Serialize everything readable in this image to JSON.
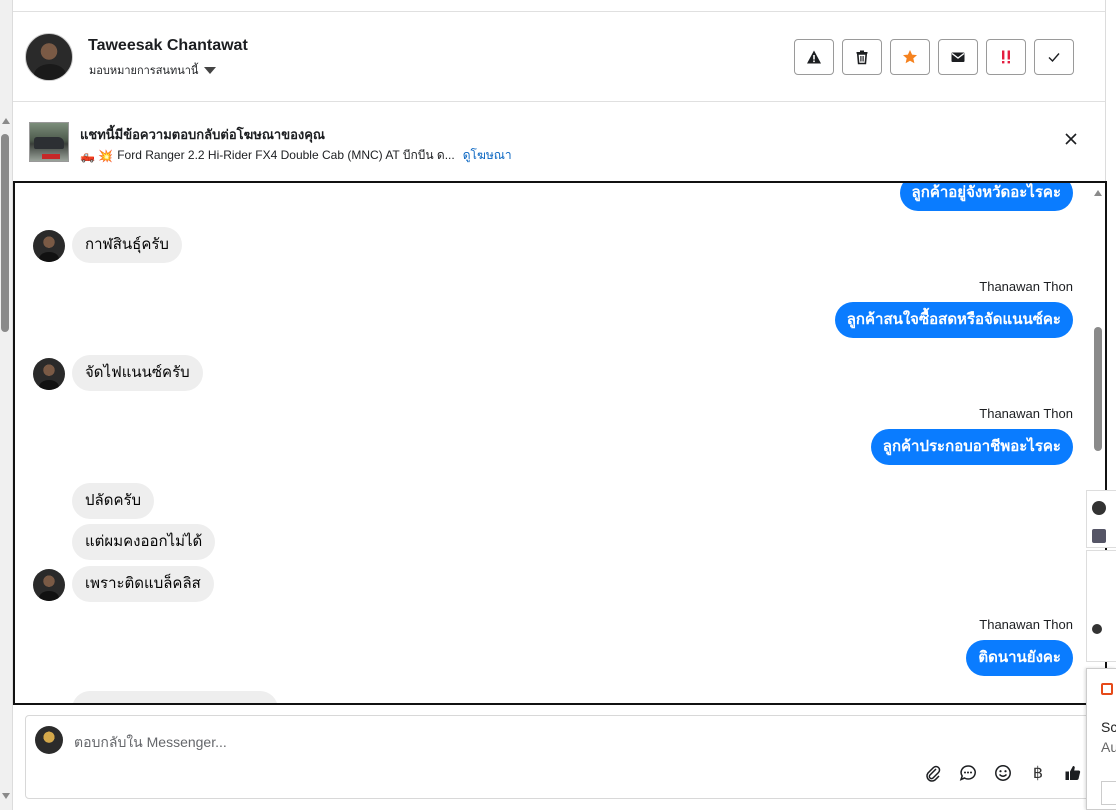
{
  "header": {
    "contact_name": "Taweesak Chantawat",
    "assign_label": "มอบหมายการสนทนานี้",
    "actions": [
      {
        "name": "spam-button",
        "icon": "warning-icon"
      },
      {
        "name": "delete-button",
        "icon": "trash-icon"
      },
      {
        "name": "star-button",
        "icon": "star-icon"
      },
      {
        "name": "mark-unread-button",
        "icon": "envelope-icon"
      },
      {
        "name": "urgent-button",
        "icon": "exclamation-icon"
      },
      {
        "name": "mark-done-button",
        "icon": "check-icon"
      }
    ],
    "colors": {
      "star": "#f5821f",
      "urgent": "#e41e3f"
    }
  },
  "ad": {
    "title": "แชทนี้มีข้อความตอบกลับต่อโฆษณาของคุณ",
    "emoji": "🛻 💥",
    "subtitle": "Ford Ranger 2.2 Hi-Rider FX4 Double Cab (MNC) AT บีกบีน ด...",
    "link": "ดูโฆษณา"
  },
  "messages": [
    {
      "dir": "out",
      "sender": "",
      "text": "ลูกค้าอยู่จังหวัดอะไรคะ"
    },
    {
      "dir": "in",
      "text": "กาฬสินธุ์ครับ"
    },
    {
      "dir": "out",
      "sender": "Thanawan Thon",
      "text": "ลูกค้าสนใจซื้อสดหรือจัดแนนซ์คะ"
    },
    {
      "dir": "in",
      "text": "จัดไฟแนนซ์ครับ"
    },
    {
      "dir": "out",
      "sender": "Thanawan Thon",
      "text": "ลูกค้าประกอบอาชีพอะไรคะ"
    },
    {
      "dir": "in",
      "text": "ปลัดครับ"
    },
    {
      "dir": "in",
      "text": "แต่ผมคงออกไม่ได้"
    },
    {
      "dir": "in",
      "text": "เพราะติดแบล็คลิส"
    },
    {
      "dir": "out",
      "sender": "Thanawan Thon",
      "text": "ติดนานยังคะ"
    }
  ],
  "composer": {
    "placeholder": "ตอบกลับใน Messenger...",
    "tools": [
      "paperclip-icon",
      "saved-reply-icon",
      "emoji-icon",
      "baht-icon",
      "thumbs-up-icon"
    ],
    "baht_glyph": "฿"
  },
  "side_popup": {
    "text1": "Sc",
    "text2": "Au"
  },
  "colors": {
    "outgoing_bubble": "#0a7cff",
    "incoming_bubble": "#eeeeee",
    "link": "#0a66c2"
  }
}
